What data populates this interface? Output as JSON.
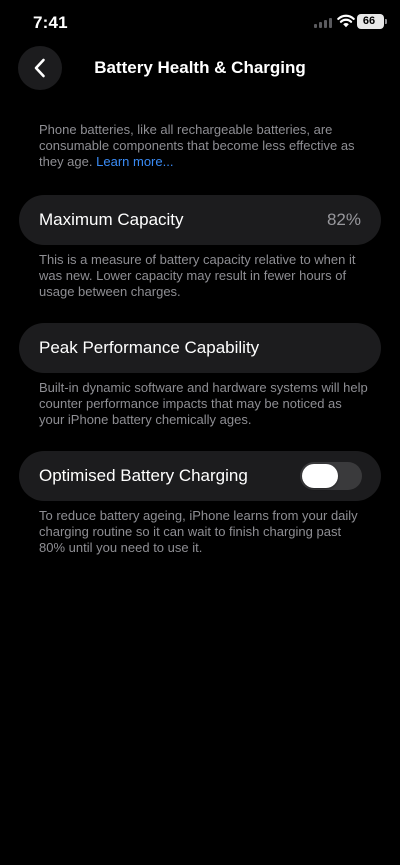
{
  "status_bar": {
    "time": "7:41",
    "battery_level": "66"
  },
  "nav": {
    "title": "Battery Health & Charging"
  },
  "intro": {
    "text": "Phone batteries, like all rechargeable batteries, are consumable components that become less effective as they age.",
    "link": "Learn more..."
  },
  "maximum_capacity": {
    "label": "Maximum Capacity",
    "value": "82%",
    "description": "This is a measure of battery capacity relative to when it was new. Lower capacity may result in fewer hours of usage between charges."
  },
  "peak_performance": {
    "label": "Peak Performance Capability",
    "description": "Built-in dynamic software and hardware systems will help counter performance impacts that may be noticed as your iPhone battery chemically ages."
  },
  "optimised_charging": {
    "label": "Optimised Battery Charging",
    "enabled": false,
    "description": "To reduce battery ageing, iPhone learns from your daily charging routine so it can wait to finish charging past 80% until you need to use it."
  },
  "colors": {
    "background": "#000000",
    "cell_background": "#1c1c1e",
    "secondary_text": "#8e8e93",
    "link": "#3a8bf5",
    "toggle_off": "#3a3a3c"
  },
  "icons": {
    "back": "chevron-left-icon",
    "signal": "signal-icon",
    "wifi": "wifi-icon",
    "battery": "battery-icon"
  }
}
